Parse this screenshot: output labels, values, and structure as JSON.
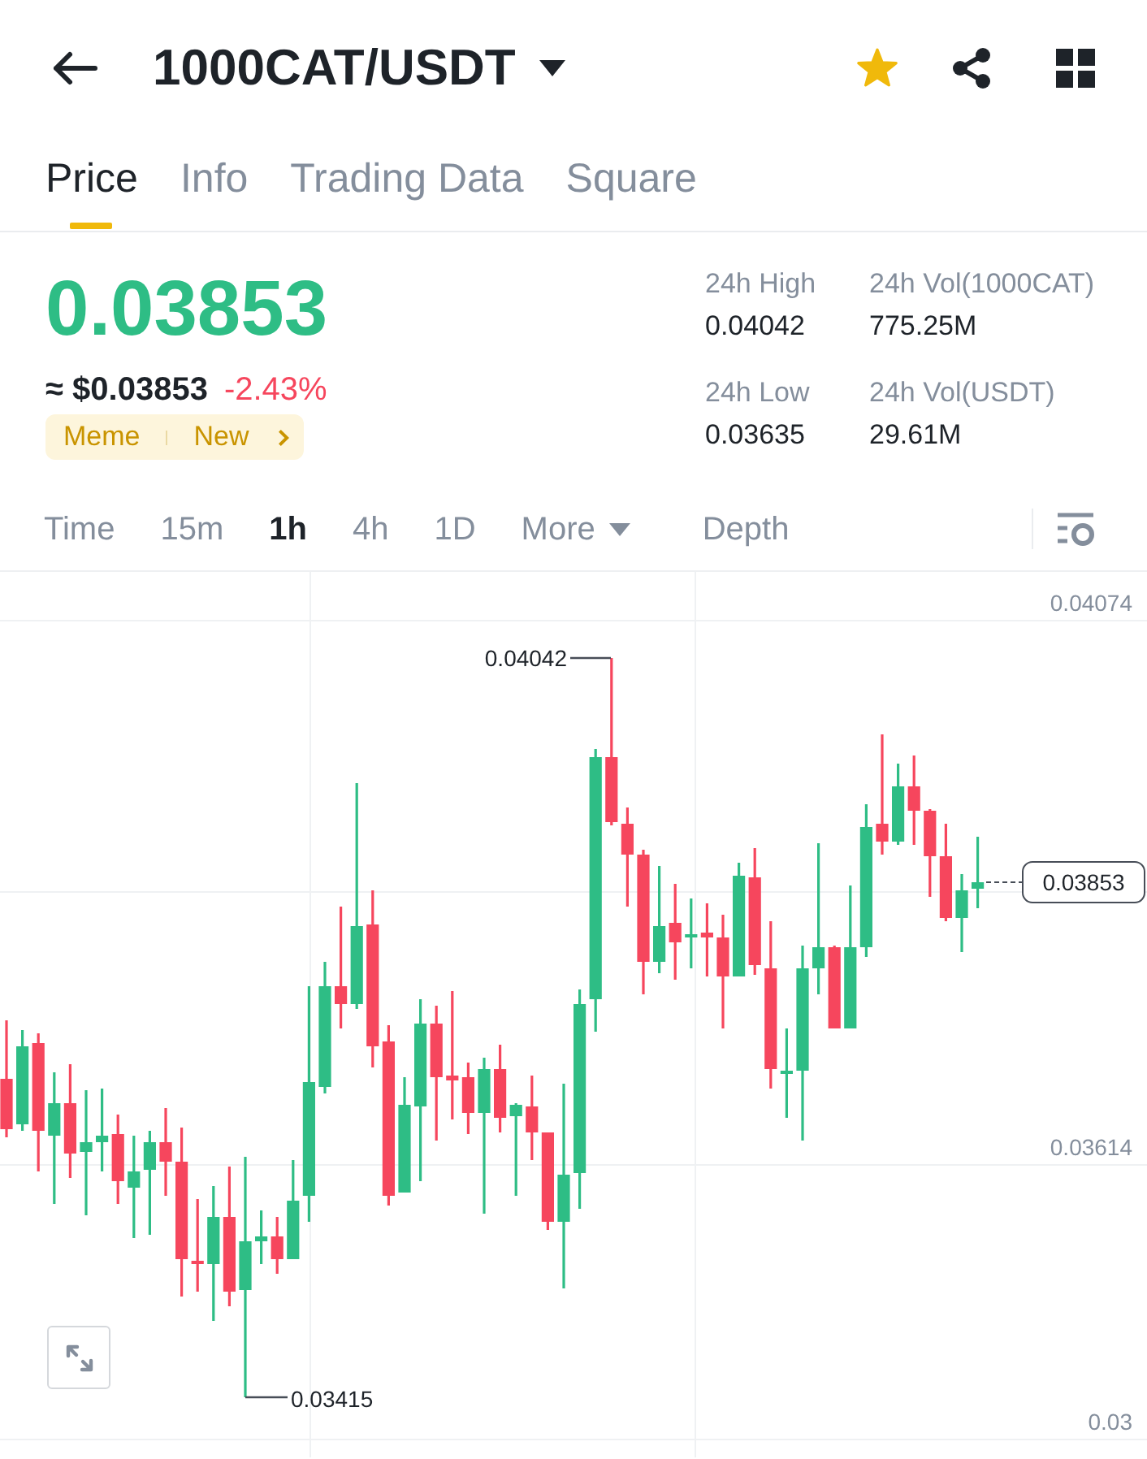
{
  "header": {
    "title": "1000CAT/USDT",
    "favorite": true
  },
  "tabs": [
    {
      "label": "Price",
      "selected": true
    },
    {
      "label": "Info",
      "selected": false
    },
    {
      "label": "Trading Data",
      "selected": false
    },
    {
      "label": "Square",
      "selected": false
    }
  ],
  "ticker": {
    "last_price": "0.03853",
    "last_tick_up": true,
    "usd_price": "≈ $0.03853",
    "change": "-2.43%",
    "change_up": false,
    "tags": [
      "Meme",
      "New"
    ]
  },
  "stats": [
    {
      "label": "24h High",
      "value": "0.04042"
    },
    {
      "label": "24h Vol(1000CAT)",
      "value": "775.25M"
    },
    {
      "label": "24h Low",
      "value": "0.03635"
    },
    {
      "label": "24h Vol(USDT)",
      "value": "29.61M"
    }
  ],
  "intervals": [
    {
      "label": "Time",
      "kind": "interval",
      "selected": false
    },
    {
      "label": "15m",
      "kind": "interval",
      "selected": false
    },
    {
      "label": "1h",
      "kind": "interval",
      "selected": true
    },
    {
      "label": "4h",
      "kind": "interval",
      "selected": false
    },
    {
      "label": "1D",
      "kind": "interval",
      "selected": false
    },
    {
      "label": "More",
      "kind": "dropdown",
      "selected": false
    },
    {
      "label": "Depth",
      "kind": "view",
      "selected": false
    }
  ],
  "chart": {
    "axis_labels": [
      "0.04074",
      "0.03614",
      "0.03"
    ],
    "high_label": "0.04042",
    "low_label": "0.03415",
    "last_price_label": "0.03853"
  }
}
